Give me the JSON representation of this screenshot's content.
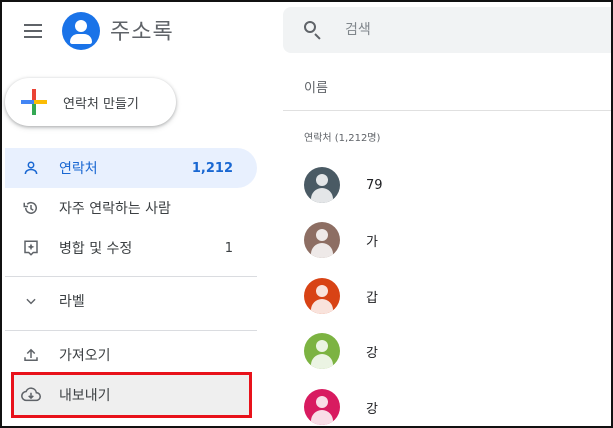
{
  "app": {
    "title": "주소록"
  },
  "create_button": {
    "label": "연락처 만들기"
  },
  "nav": [
    {
      "label": "연락처",
      "count": "1,212",
      "icon": "person-icon",
      "active": true
    },
    {
      "label": "자주 연락하는 사람",
      "count": "",
      "icon": "history-icon",
      "active": false
    },
    {
      "label": "병합 및 수정",
      "count": "1",
      "icon": "merge-sparkle-icon",
      "active": false
    },
    {
      "label": "라벨",
      "count": "",
      "icon": "chevron-down-icon",
      "active": false
    },
    {
      "label": "가져오기",
      "count": "",
      "icon": "upload-icon",
      "active": false
    },
    {
      "label": "내보내기",
      "count": "",
      "icon": "cloud-download-icon",
      "active": false
    }
  ],
  "search": {
    "placeholder": "검색"
  },
  "list": {
    "column_header": "이름",
    "section_label": "연락처 (1,212명)",
    "contacts": [
      {
        "name": "79",
        "avatar_color": "#4a5a64"
      },
      {
        "name": "가",
        "avatar_color": "#8d6e63"
      },
      {
        "name": "갑",
        "avatar_color": "#d84315"
      },
      {
        "name": "강",
        "avatar_color": "#7cb342"
      },
      {
        "name": "강",
        "avatar_color": "#d81b60"
      }
    ]
  },
  "colors": {
    "accent": "#1a73e8",
    "active_bg": "#e8f0fe",
    "highlight_box": "#e8121b"
  }
}
